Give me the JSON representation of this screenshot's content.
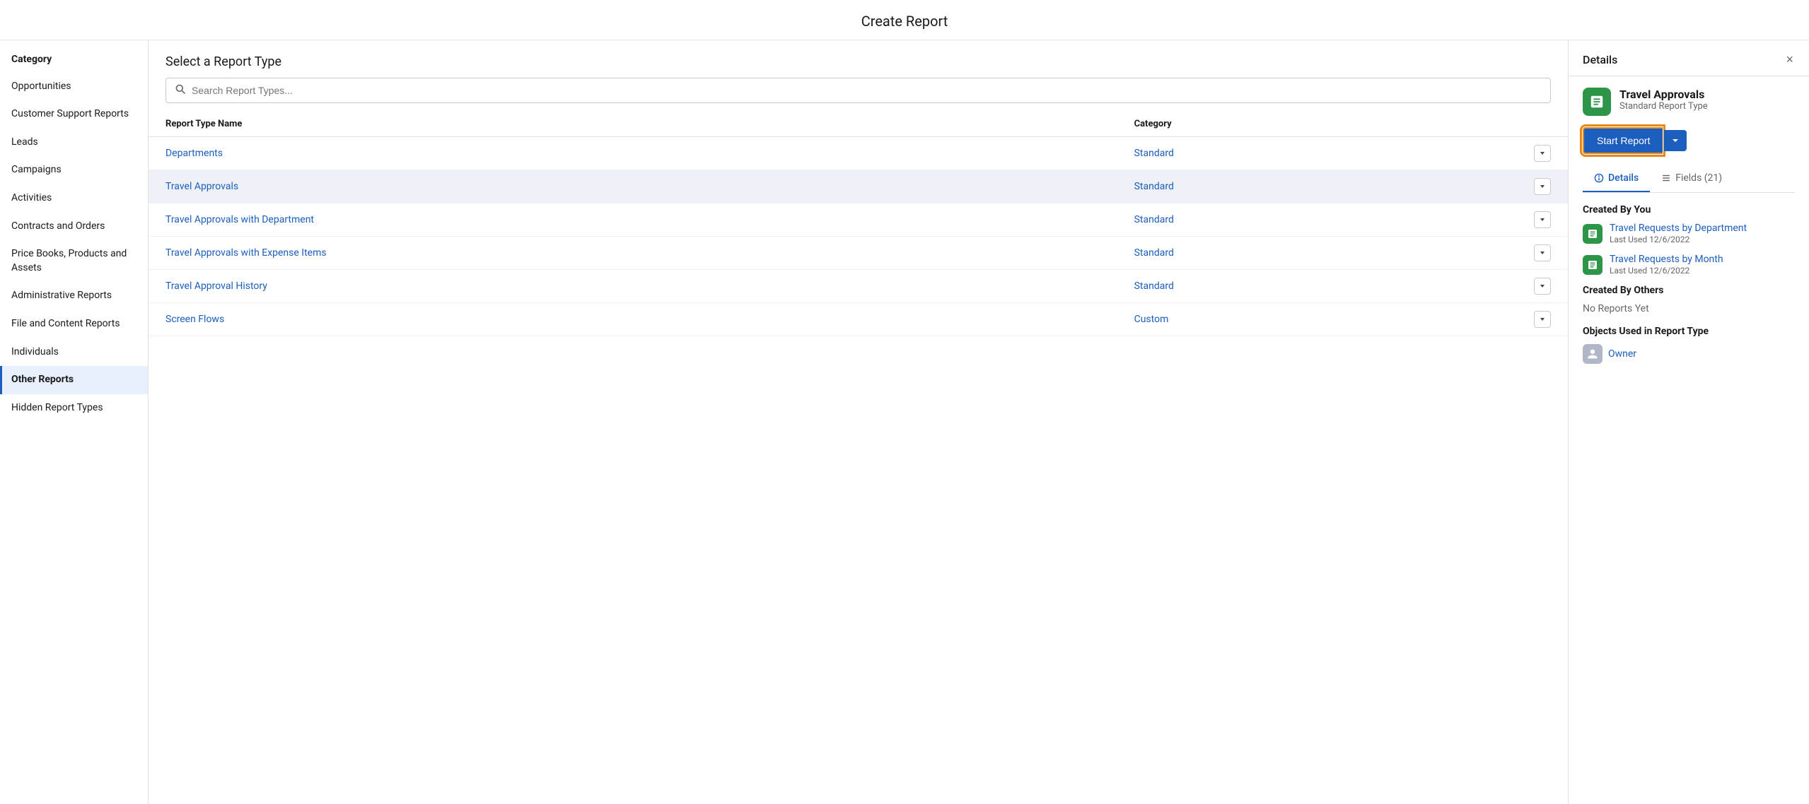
{
  "modal": {
    "title": "Create Report"
  },
  "sidebar": {
    "heading": "Category",
    "items": [
      {
        "id": "opportunities",
        "label": "Opportunities",
        "active": false
      },
      {
        "id": "customer-support",
        "label": "Customer Support Reports",
        "active": false
      },
      {
        "id": "leads",
        "label": "Leads",
        "active": false
      },
      {
        "id": "campaigns",
        "label": "Campaigns",
        "active": false
      },
      {
        "id": "activities",
        "label": "Activities",
        "active": false
      },
      {
        "id": "contracts-orders",
        "label": "Contracts and Orders",
        "active": false
      },
      {
        "id": "price-books",
        "label": "Price Books, Products and Assets",
        "active": false
      },
      {
        "id": "admin-reports",
        "label": "Administrative Reports",
        "active": false
      },
      {
        "id": "file-content",
        "label": "File and Content Reports",
        "active": false
      },
      {
        "id": "individuals",
        "label": "Individuals",
        "active": false
      },
      {
        "id": "other-reports",
        "label": "Other Reports",
        "active": true
      },
      {
        "id": "hidden-types",
        "label": "Hidden Report Types",
        "active": false
      }
    ]
  },
  "main": {
    "header": "Select a Report Type",
    "search_placeholder": "Search Report Types...",
    "table": {
      "col_name": "Report Type Name",
      "col_category": "Category",
      "rows": [
        {
          "name": "Departments",
          "category": "Standard",
          "selected": false
        },
        {
          "name": "Travel Approvals",
          "category": "Standard",
          "selected": true
        },
        {
          "name": "Travel Approvals with Department",
          "category": "Standard",
          "selected": false
        },
        {
          "name": "Travel Approvals with Expense Items",
          "category": "Standard",
          "selected": false
        },
        {
          "name": "Travel Approval History",
          "category": "Standard",
          "selected": false
        },
        {
          "name": "Screen Flows",
          "category": "Custom",
          "selected": false
        }
      ]
    }
  },
  "details": {
    "panel_title": "Details",
    "close_label": "×",
    "report_type": {
      "name": "Travel Approvals",
      "sub": "Standard Report Type"
    },
    "start_report_label": "Start Report",
    "start_report_dropdown_label": "▼",
    "tabs": [
      {
        "id": "details",
        "label": "Details",
        "icon": "info",
        "active": true
      },
      {
        "id": "fields",
        "label": "Fields (21)",
        "icon": "list",
        "active": false
      }
    ],
    "created_by_you": {
      "heading": "Created By You",
      "items": [
        {
          "name": "Travel Requests by Department",
          "meta": "Last Used 12/6/2022"
        },
        {
          "name": "Travel Requests by Month",
          "meta": "Last Used 12/6/2022"
        }
      ]
    },
    "created_by_others": {
      "heading": "Created By Others",
      "empty_text": "No Reports Yet"
    },
    "objects_section": {
      "heading": "Objects Used in Report Type",
      "owner_label": "Owner"
    }
  }
}
